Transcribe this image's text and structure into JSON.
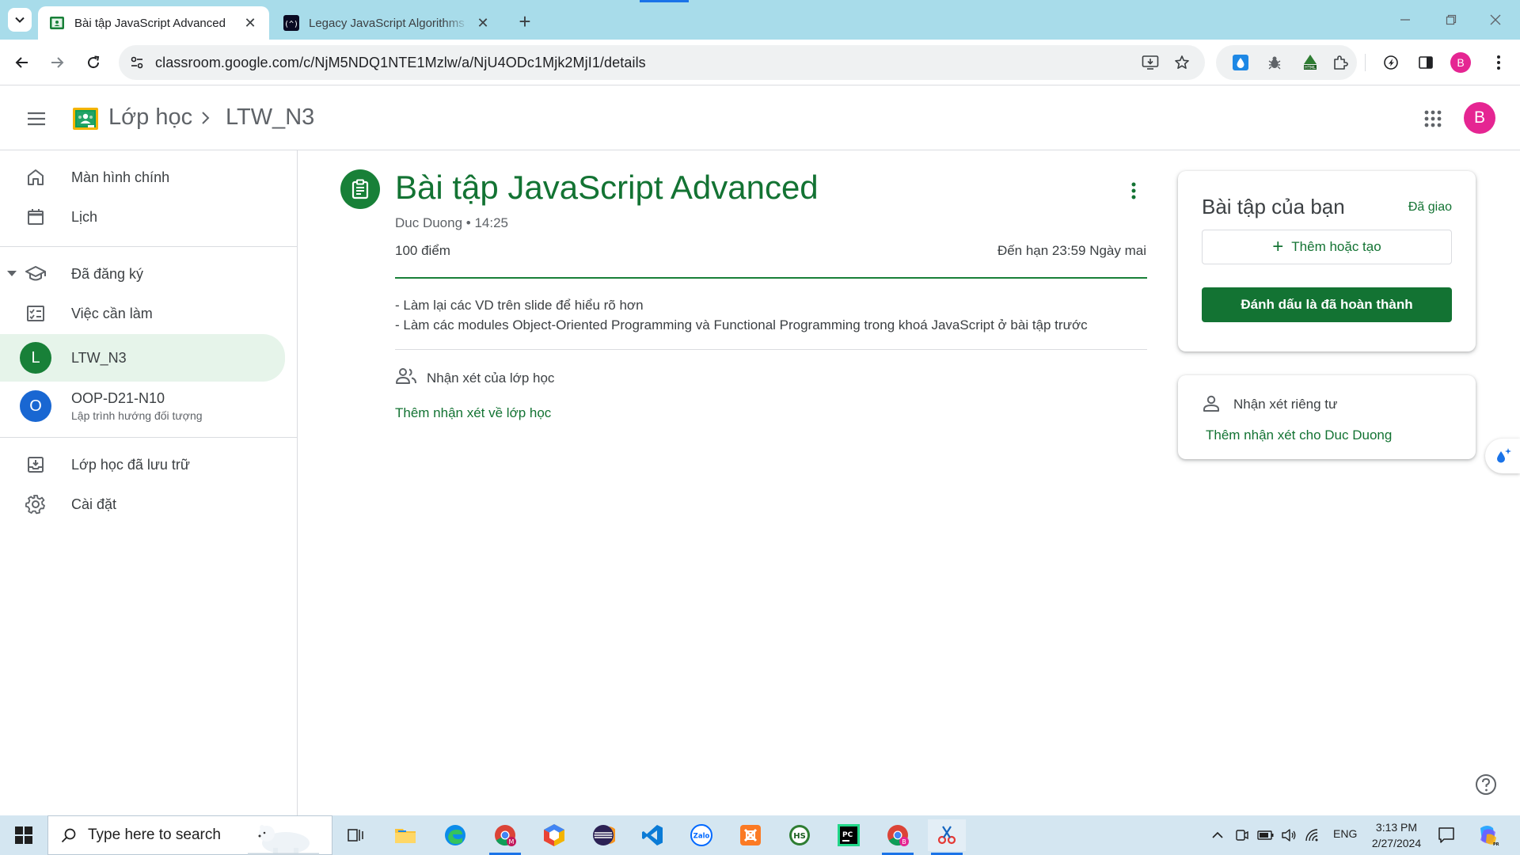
{
  "browser": {
    "tabs": [
      {
        "title": "Bài tập JavaScript Advanced",
        "active": true
      },
      {
        "title": "Legacy JavaScript Algorithms and Data Structures",
        "active": false
      }
    ],
    "url": "classroom.google.com/c/NjM5NDQ1NTE1Mzlw/a/NjU4ODc1Mjk2MjI1/details",
    "profile_initial": "B"
  },
  "header": {
    "app_title": "Lớp học",
    "class_name": "LTW_N3",
    "profile_initial": "B"
  },
  "sidebar": {
    "home": "Màn hình chính",
    "calendar": "Lịch",
    "enrolled": "Đã đăng ký",
    "todo": "Việc cần làm",
    "classes": [
      {
        "initial": "L",
        "name": "LTW_N3",
        "subtitle": "",
        "color": "#188038",
        "selected": true
      },
      {
        "initial": "O",
        "name": "OOP-D21-N10",
        "subtitle": "Lập trình hướng đối tượng",
        "color": "#1967d2",
        "selected": false
      }
    ],
    "archived": "Lớp học đã lưu trữ",
    "settings": "Cài đặt"
  },
  "assignment": {
    "title": "Bài tập JavaScript Advanced",
    "meta": "Duc Duong • 14:25",
    "points": "100 điểm",
    "due": "Đến hạn 23:59 Ngày mai",
    "instructions": [
      "- Làm lại các VD trên slide để hiểu rõ hơn",
      "- Làm các modules Object-Oriented Programming và Functional Programming trong khoá JavaScript ở bài tập trước"
    ],
    "class_comments_label": "Nhận xét của lớp học",
    "add_class_comment": "Thêm nhận xét về lớp học"
  },
  "your_work": {
    "title": "Bài tập của bạn",
    "status": "Đã giao",
    "add_or_create": "Thêm hoặc tạo",
    "mark_done": "Đánh dấu là đã hoàn thành"
  },
  "private_comments": {
    "label": "Nhận xét riêng tư",
    "add": "Thêm nhận xét cho Duc Duong"
  },
  "taskbar": {
    "search_placeholder": "Type here to search",
    "lang": "ENG",
    "time": "3:13 PM",
    "date": "2/27/2024"
  },
  "colors": {
    "accent_green": "#137333",
    "chrome_frame": "#a8dcea",
    "profile_pink": "#e52592"
  }
}
